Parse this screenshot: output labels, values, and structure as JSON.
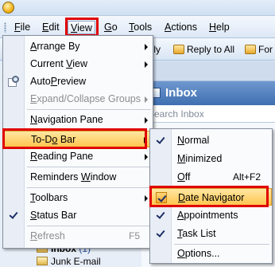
{
  "menubar": {
    "items": [
      {
        "pre": "",
        "u": "F",
        "post": "ile"
      },
      {
        "pre": "",
        "u": "E",
        "post": "dit"
      },
      {
        "pre": "",
        "u": "V",
        "post": "iew"
      },
      {
        "pre": "",
        "u": "G",
        "post": "o"
      },
      {
        "pre": "",
        "u": "T",
        "post": "ools"
      },
      {
        "pre": "",
        "u": "A",
        "post": "ctions"
      },
      {
        "pre": "",
        "u": "H",
        "post": "elp"
      }
    ]
  },
  "toolbar": {
    "reply_partial": "eply",
    "reply_all": "Reply to All",
    "forward_partial": "For"
  },
  "main": {
    "folder_title": "Inbox",
    "search_placeholder": "Search Inbox",
    "folders": [
      {
        "label": "Inbox",
        "count": "(1)"
      },
      {
        "label": "Junk E-mail"
      }
    ]
  },
  "view_menu": {
    "items": [
      {
        "pre": "",
        "u": "A",
        "post": "rrange By"
      },
      {
        "pre": "Current ",
        "u": "V",
        "post": "iew"
      },
      {
        "pre": "Auto",
        "u": "P",
        "post": "review"
      },
      {
        "pre": "",
        "u": "E",
        "post": "xpand/Collapse Groups"
      },
      {
        "pre": "",
        "u": "N",
        "post": "avigation Pane"
      },
      {
        "pre": "To-D",
        "u": "o",
        "post": " Bar"
      },
      {
        "pre": "",
        "u": "R",
        "post": "eading Pane"
      },
      {
        "pre": "Reminders ",
        "u": "W",
        "post": "indow"
      },
      {
        "pre": "",
        "u": "T",
        "post": "oolbars"
      },
      {
        "pre": "",
        "u": "S",
        "post": "tatus Bar"
      },
      {
        "pre": "",
        "u": "R",
        "post": "efresh"
      }
    ],
    "refresh_shortcut": "F5"
  },
  "todo_submenu": {
    "items": [
      {
        "pre": "",
        "u": "N",
        "post": "ormal"
      },
      {
        "pre": "",
        "u": "M",
        "post": "inimized"
      },
      {
        "pre": "",
        "u": "O",
        "post": "ff"
      },
      {
        "pre": "",
        "u": "D",
        "post": "ate Navigator"
      },
      {
        "pre": "",
        "u": "A",
        "post": "ppointments"
      },
      {
        "pre": "",
        "u": "T",
        "post": "ask List"
      },
      {
        "pre": "",
        "u": "O",
        "post": "ptions..."
      }
    ],
    "off_shortcut": "Alt+F2"
  },
  "colors": {
    "highlight_box": "#e00000",
    "hover_fill": "#ffc64f",
    "inbox_header": "#3f6fb1"
  }
}
